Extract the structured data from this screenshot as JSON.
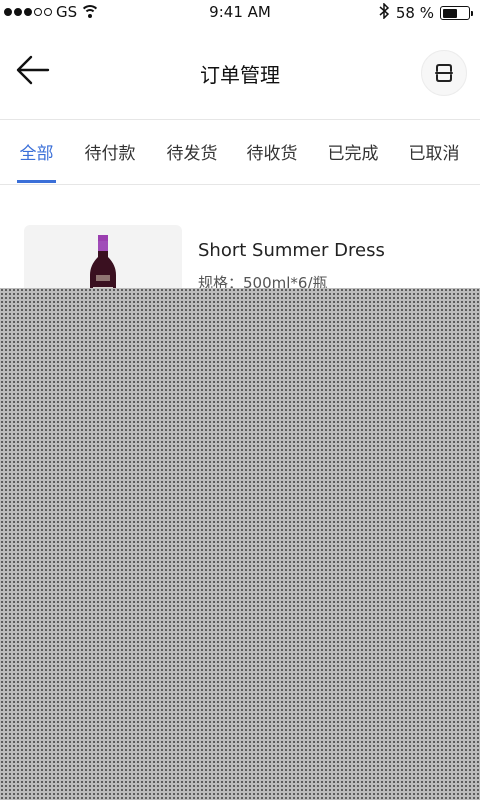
{
  "status_bar": {
    "carrier": "GS",
    "time": "9:41 AM",
    "battery": "58 %",
    "battery_level": 0.58,
    "signal_strength": 3,
    "icons": [
      "signal-dots-icon",
      "wifi-icon",
      "bluetooth-icon",
      "battery-icon"
    ]
  },
  "nav": {
    "title": "订单管理",
    "back_icon": "arrow-left-icon",
    "scan_icon": "scan-icon"
  },
  "tabs": {
    "items": [
      {
        "label": "全部",
        "active": true
      },
      {
        "label": "待付款",
        "active": false
      },
      {
        "label": "待发货",
        "active": false
      },
      {
        "label": "待收货",
        "active": false
      },
      {
        "label": "已完成",
        "active": false
      },
      {
        "label": "已取消",
        "active": false
      }
    ],
    "accent_color": "#3a6fd8"
  },
  "order": {
    "product_name": "Short Summer Dress",
    "spec_label": "规格：",
    "spec_value": "500ml*6/瓶",
    "image": "wine-bottle"
  },
  "colors": {
    "accent": "#3a6fd8",
    "divider": "#e6e6e6",
    "thumb_bg": "#f3f3f3"
  }
}
